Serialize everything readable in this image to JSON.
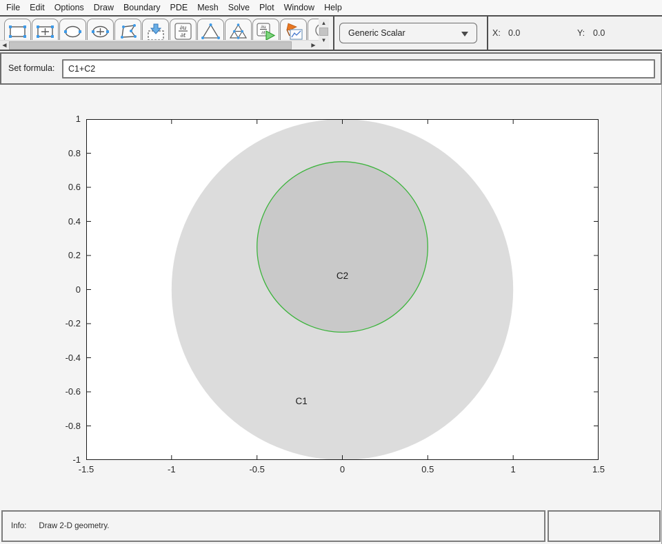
{
  "menu": {
    "items": [
      "File",
      "Edit",
      "Options",
      "Draw",
      "Boundary",
      "PDE",
      "Mesh",
      "Solve",
      "Plot",
      "Window",
      "Help"
    ]
  },
  "toolbar": {
    "tools": [
      "draw-rectangle-corners",
      "draw-rectangle-center",
      "draw-ellipse-corners",
      "draw-ellipse-center",
      "draw-polygon",
      "boundary-mode",
      "pde-mode",
      "initialize-mesh",
      "refine-mesh",
      "solve-pde",
      "plot-solution",
      "zoom"
    ],
    "pde_type": {
      "value": "Generic Scalar"
    },
    "coords": {
      "x_label": "X:",
      "x_value": "0.0",
      "y_label": "Y:",
      "y_value": "0.0"
    }
  },
  "formula_bar": {
    "label": "Set formula:",
    "value": "C1+C2"
  },
  "canvas": {
    "plot": {
      "xlim": [
        -1.5,
        1.5
      ],
      "ylim": [
        -1,
        1
      ],
      "xticks": {
        "values": [
          -1.5,
          -1,
          -0.5,
          0,
          0.5,
          1,
          1.5
        ],
        "labels": [
          "-1.5",
          "-1",
          "-0.5",
          "0",
          "0.5",
          "1",
          "1.5"
        ]
      },
      "yticks": {
        "values": [
          1,
          0.8,
          0.6,
          0.4,
          0.2,
          0,
          -0.2,
          -0.4,
          -0.6,
          -0.8,
          -1
        ],
        "labels": [
          "1",
          "0.8",
          "0.6",
          "0.4",
          "0.2",
          "0",
          "-0.2",
          "-0.4",
          "-0.6",
          "-0.8",
          "-1"
        ]
      },
      "axis_color": "#1a1a1a",
      "shapes": [
        {
          "type": "circle",
          "label": "C1",
          "center": [
            0,
            0
          ],
          "radius": 1,
          "fill": "#dcdcdc",
          "stroke": "none",
          "label_pos": [
            -0.24,
            -0.655
          ]
        },
        {
          "type": "circle",
          "label": "C2",
          "center": [
            0,
            0.25
          ],
          "radius": 0.5,
          "fill": "#c9c9c9",
          "stroke": "#3cb43c",
          "label_pos": [
            0,
            0.08
          ]
        }
      ]
    }
  },
  "status_bar": {
    "info_label": "Info:",
    "message": "Draw 2-D geometry."
  },
  "colors": {
    "selection_handle_blue": "#3d9ae8",
    "boundary_green": "#3cb43c",
    "solve_play_green": "#7ed47e",
    "plot_flag_orange": "#e87722",
    "shape_fill_light": "#dcdcdc",
    "shape_fill_dark": "#c9c9c9"
  }
}
